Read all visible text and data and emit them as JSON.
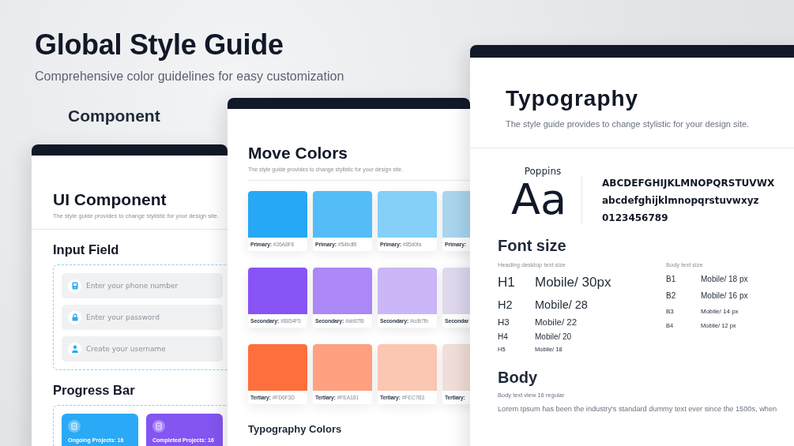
{
  "header": {
    "title": "Global Style Guide",
    "subtitle": "Comprehensive color guidelines for easy customization",
    "section_label": "Component"
  },
  "ui_component": {
    "title": "UI Component",
    "subtitle": "The style guide provides to change stylistic for your design site.",
    "input_section": {
      "title": "Input Field",
      "fields": [
        {
          "kind": "phone",
          "placeholder": "Enter your phone number"
        },
        {
          "kind": "lock",
          "placeholder": "Enter your password"
        },
        {
          "kind": "user",
          "placeholder": "Create your username"
        }
      ]
    },
    "progress_section": {
      "title": "Progress Bar",
      "cards": [
        {
          "label": "Ongoing Projects: 16",
          "color": "#2aa9f6"
        },
        {
          "label": "Completed Projects: 16",
          "color": "#8455f1"
        }
      ]
    }
  },
  "colors": {
    "title": "Move Colors",
    "subtitle": "The style guide provides to change stylistic for your design site.",
    "rows": [
      {
        "swatches": [
          {
            "label": "Primary:",
            "hex": "#26A8F6",
            "color": "#26a8f6"
          },
          {
            "label": "Primary:",
            "hex": "#54bdf8",
            "color": "#54bdf8"
          },
          {
            "label": "Primary:",
            "hex": "#85d0fa",
            "color": "#85d0f8"
          },
          {
            "label": "Primary:",
            "color": "#a9d5ee"
          }
        ]
      },
      {
        "swatches": [
          {
            "label": "Secondary:",
            "hex": "#8854F5",
            "color": "#8854f5"
          },
          {
            "label": "Secondary:",
            "hex": "#ab87f8",
            "color": "#ab87f8"
          },
          {
            "label": "Secondary:",
            "hex": "#cdb7fb",
            "color": "#cbb6f8"
          },
          {
            "label": "Secondar",
            "color": "#dfd8ee"
          }
        ]
      },
      {
        "swatches": [
          {
            "label": "Tertiary:",
            "hex": "#FD6F3D",
            "color": "#fd6f3d"
          },
          {
            "label": "Tertiary:",
            "hex": "#FEA181",
            "color": "#fea181"
          },
          {
            "label": "Tertiary:",
            "hex": "#FEC7B3",
            "color": "#fbc6b2"
          },
          {
            "label": "Tertiary:",
            "color": "#f1ded8"
          }
        ]
      }
    ],
    "footer_heading": "Typography Colors"
  },
  "typography": {
    "title": "Typography",
    "subtitle": "The style guide provides to change stylistic for your design site.",
    "font_name": "Poppins",
    "sample": "Aa",
    "uppercase": "ABCDEFGHIJKLMNOPQRSTUVWX",
    "lowercase": "abcdefghijklmnopqrstuvwxyz",
    "digits": "0123456789",
    "font_size": {
      "title": "Font size",
      "heading": {
        "caption": "Heading desktop text size",
        "rows": [
          {
            "label": "H1",
            "value": "Mobile/ 30px"
          },
          {
            "label": "H2",
            "value": "Mobile/ 28"
          },
          {
            "label": "H3",
            "value": "Mobile/ 22"
          },
          {
            "label": "H4",
            "value": "Mobile/ 20"
          },
          {
            "label": "H5",
            "value": "Mobile/ 18"
          }
        ]
      },
      "body": {
        "caption": "Body text size",
        "rows": [
          {
            "label": "B1",
            "value": "Mobile/ 18 px"
          },
          {
            "label": "B2",
            "value": "Mobile/ 16 px"
          },
          {
            "label": "B3",
            "value": "Mobile/ 14 px"
          },
          {
            "label": "B4",
            "value": "Mobile/ 12 px"
          }
        ]
      }
    },
    "body": {
      "title": "Body",
      "caption": "Body text view 16 regular",
      "text": "Lorem Ipsum has been the industry's standard dummy text ever since the 1500s, when"
    }
  }
}
